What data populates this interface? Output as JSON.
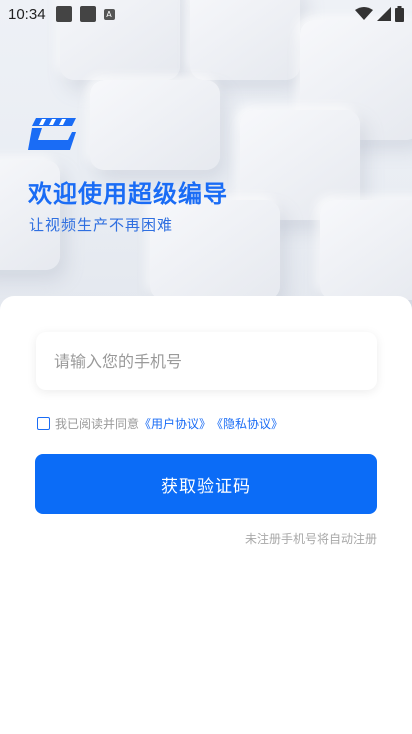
{
  "status_bar": {
    "time": "10:34",
    "notif_badge": "A"
  },
  "hero": {
    "title": "欢迎使用超级编导",
    "subtitle": "让视频生产不再困难"
  },
  "login": {
    "phone_placeholder": "请输入您的手机号",
    "agree_prefix": "我已阅读并同意",
    "user_agreement": "《用户协议》",
    "privacy_agreement": "《隐私协议》",
    "submit_label": "获取验证码",
    "hint": "未注册手机号将自动注册"
  },
  "colors": {
    "accent": "#1a6cf5",
    "button": "#0b6cf7"
  },
  "icons": {
    "logo": "clapperboard-logo-icon",
    "wifi": "wifi-icon",
    "signal": "signal-icon",
    "battery": "battery-icon"
  }
}
